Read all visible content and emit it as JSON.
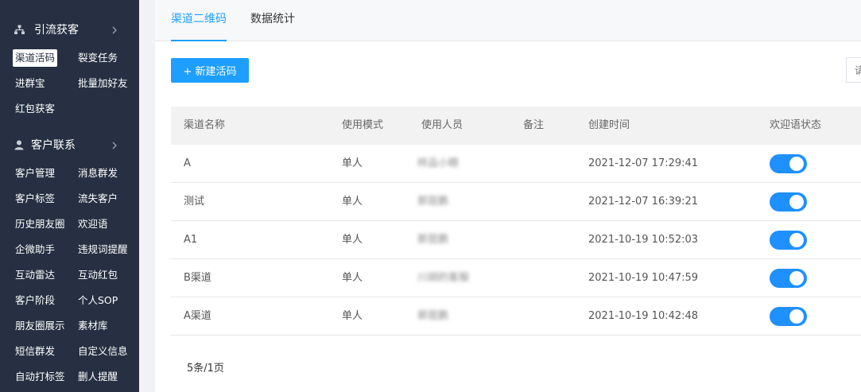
{
  "sidebar": {
    "sections": [
      {
        "title": "引流获客",
        "icon": "sitemap-icon",
        "items": [
          "渠道活码",
          "裂变任务",
          "进群宝",
          "批量加好友",
          "红包获客"
        ],
        "active": "渠道活码"
      },
      {
        "title": "客户联系",
        "icon": "user-icon",
        "items": [
          "客户管理",
          "消息群发",
          "客户标签",
          "流失客户",
          "历史朋友圈",
          "欢迎语",
          "企微助手",
          "违规词提醒",
          "互动雷达",
          "互动红包",
          "客户阶段",
          "个人SOP",
          "朋友圈展示",
          "素材库",
          "短信群发",
          "自定义信息",
          "自动打标签",
          "删人提醒"
        ]
      }
    ]
  },
  "tabs": [
    {
      "label": "渠道二维码",
      "active": true
    },
    {
      "label": "数据统计",
      "active": false
    }
  ],
  "toolbar": {
    "new_button": "+ 新建活码",
    "search_placeholder": "请"
  },
  "table": {
    "columns": [
      "渠道名称",
      "使用模式",
      "使用人员",
      "备注",
      "创建时间",
      "欢迎语状态"
    ],
    "rows": [
      {
        "name": "A",
        "mode": "单人",
        "staff": "样品小眼",
        "note": "",
        "created": "2021-12-07 17:29:41",
        "welcome_on": true
      },
      {
        "name": "测试",
        "mode": "单人",
        "staff": "郭昆鹏",
        "note": "",
        "created": "2021-12-07 16:39:21",
        "welcome_on": true
      },
      {
        "name": "A1",
        "mode": "单人",
        "staff": "郭昆鹏",
        "note": "",
        "created": "2021-10-19 10:52:03",
        "welcome_on": true
      },
      {
        "name": "B渠道",
        "mode": "单人",
        "staff": "川胡的客服",
        "note": "",
        "created": "2021-10-19 10:47:59",
        "welcome_on": true
      },
      {
        "name": "A渠道",
        "mode": "单人",
        "staff": "郭昆鹏",
        "note": "",
        "created": "2021-10-19 10:42:48",
        "welcome_on": true
      }
    ]
  },
  "pagination": {
    "summary": "5条/1页"
  },
  "colors": {
    "sidebar_bg": "#263042",
    "accent": "#1e9fff",
    "toggle_on": "#1e90ff"
  }
}
